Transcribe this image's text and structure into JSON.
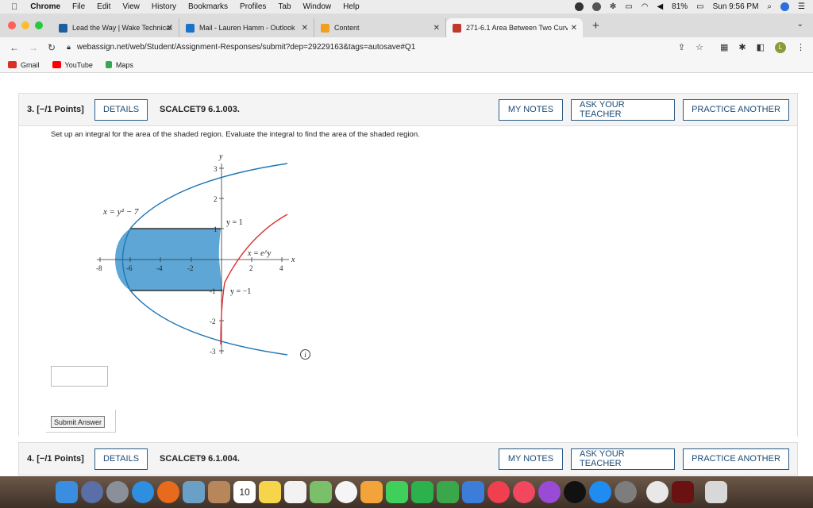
{
  "menubar": {
    "app": "Chrome",
    "items": [
      "File",
      "Edit",
      "View",
      "History",
      "Bookmarks",
      "Profiles",
      "Tab",
      "Window",
      "Help"
    ],
    "battery": "81%",
    "clock": "Sun 9:56 PM"
  },
  "tabs": [
    {
      "label": "Lead the Way | Wake Technical",
      "color": "#1f5e9e"
    },
    {
      "label": "Mail - Lauren Hamm - Outlook",
      "color": "#1a73c9"
    },
    {
      "label": "Content",
      "color": "#f0a020"
    },
    {
      "label": "271-6.1 Area Between Two Curves",
      "color": "#c0392b"
    }
  ],
  "address": {
    "url": "webassign.net/web/Student/Assignment-Responses/submit?dep=29229163&tags=autosave#Q1",
    "avatar": "L"
  },
  "bookmarks": [
    {
      "label": "Gmail",
      "color": "#d93025"
    },
    {
      "label": "YouTube",
      "color": "#ff0000"
    },
    {
      "label": "Maps",
      "color": "#34a853"
    }
  ],
  "q3": {
    "number": "3.  [−/1 Points]",
    "details": "DETAILS",
    "code": "SCALCET9 6.1.003.",
    "notes": "MY NOTES",
    "ask": "ASK YOUR TEACHER",
    "practice": "PRACTICE ANOTHER",
    "prompt": "Set up an integral for the area of the shaded region. Evaluate the integral to find the area of the shaded region.",
    "submit": "Submit Answer"
  },
  "graph": {
    "xaxis": "x",
    "yaxis": "y",
    "x_ticks": [
      "-8",
      "-6",
      "-4",
      "-2",
      "2",
      "4"
    ],
    "y_ticks": [
      "3",
      "2",
      "1",
      "-1",
      "-2",
      "-3"
    ],
    "labels": {
      "parabola": "x = y² − 7",
      "top": "y = 1",
      "exp": "x = e^y",
      "bottom": "y = −1"
    },
    "colors": {
      "parabola": "#1f77b4",
      "exp": "#e03030",
      "shade": "#5da6d6"
    }
  },
  "q4": {
    "number": "4.  [−/1 Points]",
    "details": "DETAILS",
    "code": "SCALCET9 6.1.004.",
    "notes": "MY NOTES",
    "ask": "ASK YOUR TEACHER",
    "practice": "PRACTICE ANOTHER"
  },
  "dock": {
    "badge_calendar": "10"
  }
}
